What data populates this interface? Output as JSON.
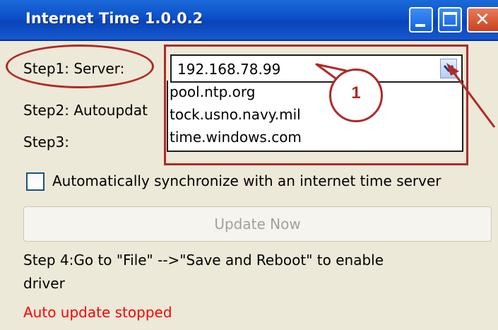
{
  "window": {
    "title": "Internet Time 1.0.0.2"
  },
  "step1": {
    "label": "Step1: Server:"
  },
  "server_combo": {
    "value": "192.168.78.99",
    "options": [
      "pool.ntp.org",
      "tock.usno.navy.mil",
      "time.windows.com"
    ]
  },
  "step2": {
    "label": "Step2: Autoupdat"
  },
  "step3": {
    "label": "Step3:"
  },
  "callout": {
    "number": "1"
  },
  "auto_sync": {
    "label": "Automatically synchronize with an internet time server",
    "checked": false
  },
  "update_button": {
    "label": "Update Now",
    "enabled": false
  },
  "step4": {
    "line1": "Step 4:Go to \"File\" -->\"Save and Reboot\" to enable",
    "line2": "driver"
  },
  "status": {
    "text": "Auto update stopped",
    "color": "#ff0000"
  },
  "colors": {
    "annotation": "#b02a2a",
    "titlebar": "#0c4fc9"
  },
  "icons": {
    "minimize": "minimize-icon",
    "maximize": "maximize-icon",
    "close": "close-icon",
    "dropdown": "chevron-down-icon"
  }
}
